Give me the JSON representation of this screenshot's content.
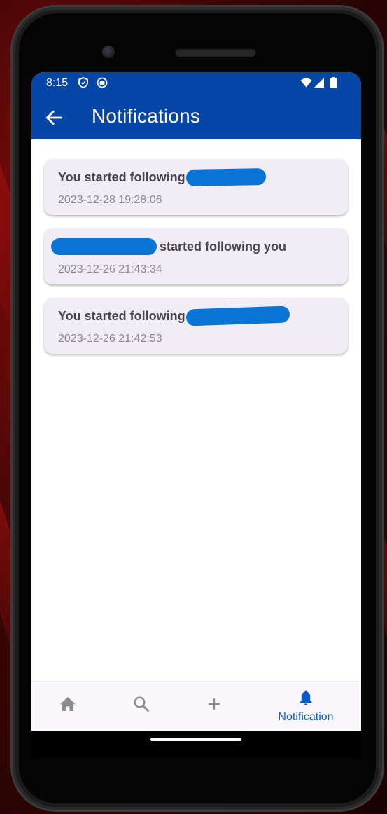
{
  "status_bar": {
    "time": "8:15"
  },
  "app_bar": {
    "title": "Notifications"
  },
  "notifications": [
    {
      "prefix": "You started following",
      "suffix": "",
      "timestamp": "2023-12-28 19:28:06"
    },
    {
      "prefix": "",
      "suffix": "started following you",
      "timestamp": "2023-12-26 21:43:34"
    },
    {
      "prefix": "You started following",
      "suffix": "",
      "timestamp": "2023-12-26 21:42:53"
    }
  ],
  "bottom_nav": {
    "active_label": "Notification",
    "items": [
      "home-icon",
      "search-icon",
      "add-icon",
      "bell-icon"
    ]
  },
  "colors": {
    "primary": "#0646a6",
    "accent": "#0a5bc4",
    "card_background": "#f1edf4",
    "redaction": "#0a74d4"
  }
}
